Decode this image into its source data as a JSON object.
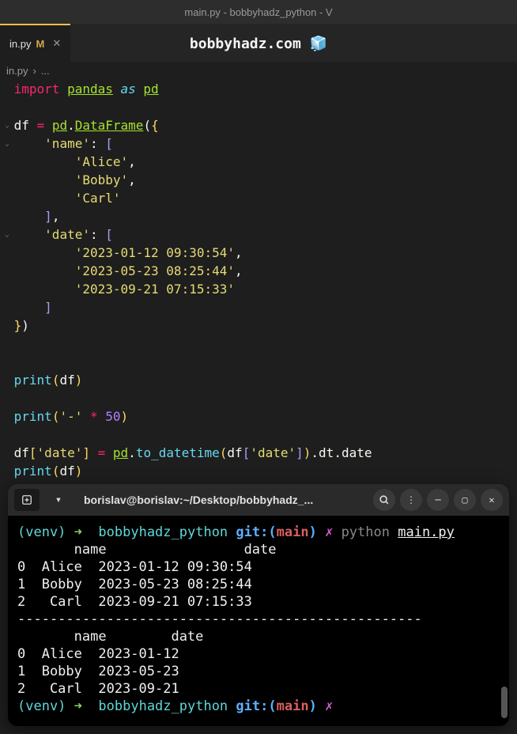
{
  "window": {
    "title": "main.py - bobbyhadz_python - V"
  },
  "tab": {
    "filename": "in.py",
    "modified_indicator": "M"
  },
  "watermark": {
    "text": "bobbyhadz.com",
    "emoji": "🧊"
  },
  "breadcrumb": {
    "file": "in.py",
    "sep": "›",
    "rest": "..."
  },
  "code": {
    "import_kw": "import",
    "pandas": "pandas",
    "as_kw": "as",
    "pd": "pd",
    "df": "df",
    "equals": "=",
    "dataframe": "DataFrame",
    "name_key": "'name'",
    "alice": "'Alice'",
    "bobby": "'Bobby'",
    "carl": "'Carl'",
    "date_key": "'date'",
    "d1": "'2023-01-12 09:30:54'",
    "d2": "'2023-05-23 08:25:44'",
    "d3": "'2023-09-21 07:15:33'",
    "print": "print",
    "dash": "'-'",
    "fifty": "50",
    "to_datetime": "to_datetime",
    "dt": "dt",
    "date_attr": "date"
  },
  "terminal": {
    "header_title": "borislav@borislav:~/Desktop/bobbyhadz_...",
    "venv": "(venv)",
    "arrow": "➜",
    "dir": "bobbyhadz_python",
    "git_label": "git:(",
    "branch": "main",
    "git_close": ")",
    "dirty": "✗",
    "cmd_python": "python",
    "cmd_file": "main.py",
    "out_header1": "       name                 date",
    "out_r0": "0  Alice  2023-01-12 09:30:54",
    "out_r1": "1  Bobby  2023-05-23 08:25:44",
    "out_r2": "2   Carl  2023-09-21 07:15:33",
    "out_sep": "--------------------------------------------------",
    "out_header2": "       name        date",
    "out_s0": "0  Alice  2023-01-12",
    "out_s1": "1  Bobby  2023-05-23",
    "out_s2": "2   Carl  2023-09-21"
  }
}
